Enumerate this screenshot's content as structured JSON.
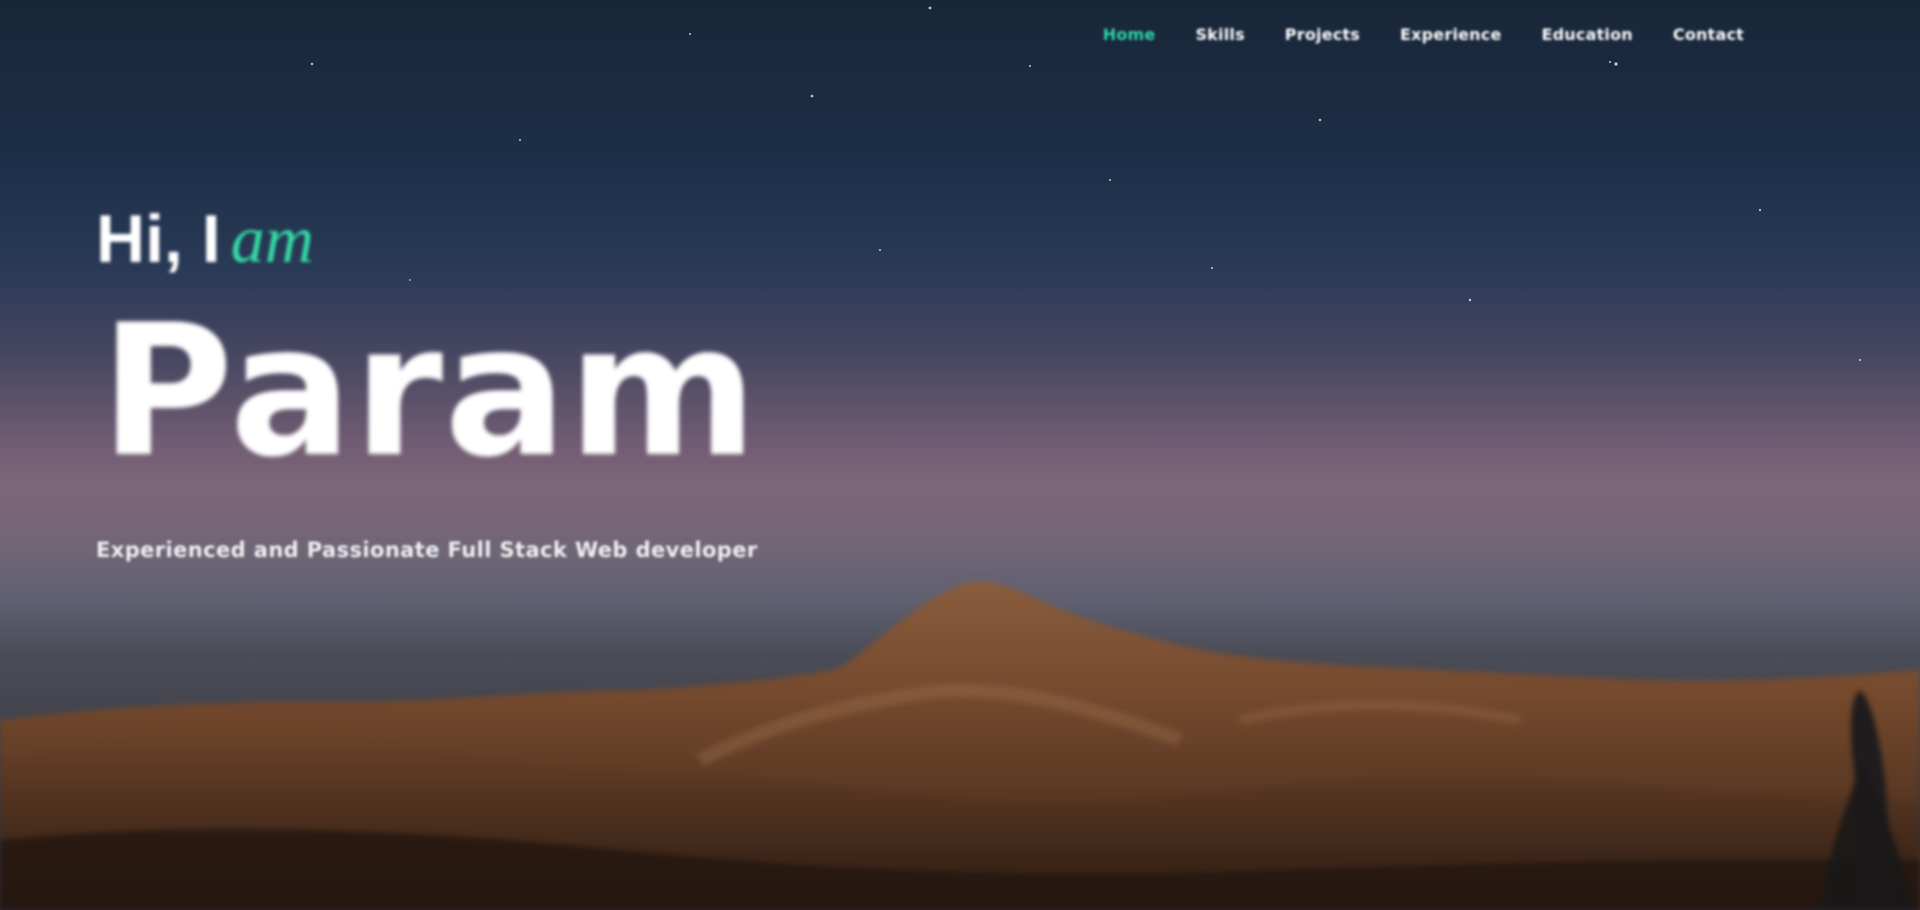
{
  "nav": {
    "items": [
      {
        "label": "Home",
        "active": true
      },
      {
        "label": "Skills",
        "active": false
      },
      {
        "label": "Projects",
        "active": false
      },
      {
        "label": "Experience",
        "active": false
      },
      {
        "label": "Education",
        "active": false
      },
      {
        "label": "Contact",
        "active": false
      }
    ]
  },
  "hero": {
    "greeting_prefix": "Hi, I",
    "greeting_accent": "am",
    "name": "Param",
    "tagline": "Experienced and Passionate Full Stack Web developer"
  },
  "colors": {
    "accent": "#2fd6a8",
    "text": "#ffffff"
  }
}
